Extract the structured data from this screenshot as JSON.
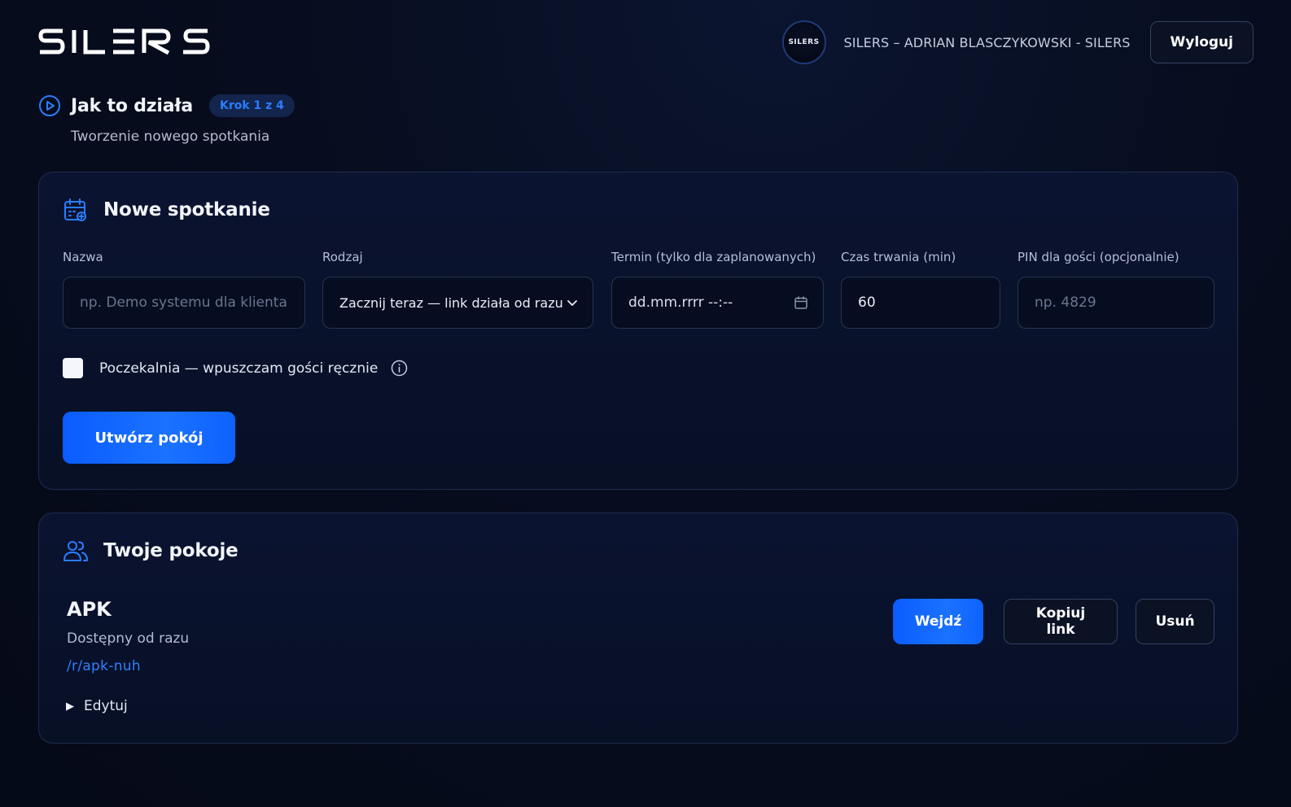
{
  "header": {
    "logo_text": "SILERS",
    "avatar_text": "SILERS",
    "user_name": "SILERS – ADRIAN BLASCZYKOWSKI - SILERS",
    "logout_label": "Wyloguj"
  },
  "step": {
    "title": "Jak to działa",
    "badge": "Krok 1 z 4",
    "subtitle": "Tworzenie nowego spotkania"
  },
  "new_meeting": {
    "title": "Nowe spotkanie",
    "fields": {
      "name": {
        "label": "Nazwa",
        "placeholder": "np. Demo systemu dla klienta",
        "value": ""
      },
      "type": {
        "label": "Rodzaj",
        "value": "Zacznij teraz — link działa od razu"
      },
      "term": {
        "label": "Termin (tylko dla zaplanowanych)",
        "placeholder": "dd.mm.rrrr --:--"
      },
      "duration": {
        "label": "Czas trwania (min)",
        "value": "60"
      },
      "pin": {
        "label": "PIN dla gości (opcjonalnie)",
        "placeholder": "np. 4829"
      }
    },
    "waiting_room_label": "Poczekalnia — wpuszczam gości ręcznie",
    "waiting_room_checked": false,
    "create_button": "Utwórz pokój"
  },
  "rooms": {
    "title": "Twoje pokoje",
    "items": [
      {
        "name": "APK",
        "status": "Dostępny od razu",
        "link": "/r/apk-nuh",
        "edit_label": "Edytuj",
        "enter_label": "Wejdź",
        "copy_label": "Kopiuj link",
        "delete_label": "Usuń"
      }
    ]
  },
  "colors": {
    "background": "#060c1c",
    "accent": "#0a5cff",
    "link": "#2f80ff",
    "badge_bg": "#13254d"
  },
  "icons": {
    "step": "play-circle-icon",
    "new_meeting": "calendar-add-icon",
    "rooms": "users-icon",
    "type": "chevron-down-icon",
    "term": "calendar-icon",
    "info": "info-icon",
    "edit": "triangle-right-icon"
  }
}
